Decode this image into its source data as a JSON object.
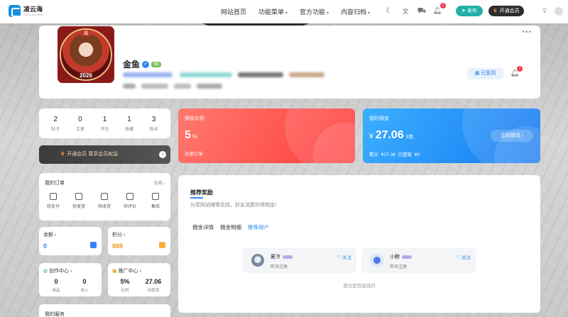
{
  "header": {
    "logo_title": "凌云海",
    "logo_sub": "SOCIALHUB",
    "nav": [
      {
        "label": "网站首页",
        "dropdown": false
      },
      {
        "label": "功能菜单",
        "dropdown": true
      },
      {
        "label": "官方功能",
        "dropdown": true
      },
      {
        "label": "内容归档",
        "dropdown": true
      }
    ],
    "notif_count": "7",
    "publish_label": "发布",
    "vip_label": "开通会员"
  },
  "profile": {
    "avatar_banner": "福",
    "avatar_year": "2026",
    "name": "金鱼",
    "verified_mark": "✓",
    "level": "V3",
    "sign_label": "已签到",
    "notif_count": "7"
  },
  "stats": [
    {
      "value": "2",
      "label": "帖子"
    },
    {
      "value": "0",
      "label": "文章"
    },
    {
      "value": "1",
      "label": "评论"
    },
    {
      "value": "1",
      "label": "收藏"
    },
    {
      "value": "3",
      "label": "粉丝"
    }
  ],
  "vip_bar": {
    "label": "开通会员  尊享会员权益"
  },
  "orders": {
    "title": "我的订单",
    "all_label": "全部",
    "items": [
      {
        "label": "待支付",
        "icon": "wallet-icon"
      },
      {
        "label": "待发货",
        "icon": "box-icon"
      },
      {
        "label": "待收货",
        "icon": "truck-icon"
      },
      {
        "label": "待评价",
        "icon": "comment-icon"
      },
      {
        "label": "售后",
        "icon": "service-icon"
      }
    ]
  },
  "balance": {
    "title": "余额",
    "value": "0",
    "color": "#2a8fee"
  },
  "points": {
    "title": "积分",
    "value": "888",
    "color": "#f39a1f"
  },
  "creator": {
    "title": "创作中心",
    "items": [
      {
        "value": "0",
        "label": "商品"
      },
      {
        "value": "0",
        "label": "收入"
      }
    ]
  },
  "promo": {
    "title": "推广中心",
    "items": [
      {
        "value": "5%",
        "label": "比例"
      },
      {
        "value": "27.06",
        "label": "待提现"
      }
    ]
  },
  "services": {
    "title": "我的服务"
  },
  "commission_rate": {
    "title": "佣金比例",
    "value": "5",
    "unit": "%",
    "sub": "全部订单"
  },
  "my_commission": {
    "title": "我的佣金",
    "currency": "¥",
    "value": "27.06",
    "count": "3笔",
    "sub": "累计 ¥27.06    已提现 ¥0",
    "withdraw_label": "立即提现"
  },
  "rewards": {
    "title": "推荐奖励",
    "desc": "分享网站赚零花钱，好友消费你得佣金!",
    "tabs": [
      {
        "label": "佣金详情",
        "active": false
      },
      {
        "label": "佣金明细",
        "active": false
      },
      {
        "label": "推荐用户",
        "active": true
      }
    ],
    "users": [
      {
        "name": "夏冷",
        "joined": "昨天注册",
        "follow": "关注"
      },
      {
        "name": "小鲸",
        "joined": "昨天注册",
        "follow": "关注"
      }
    ],
    "end_text": "我也是有底线的"
  }
}
